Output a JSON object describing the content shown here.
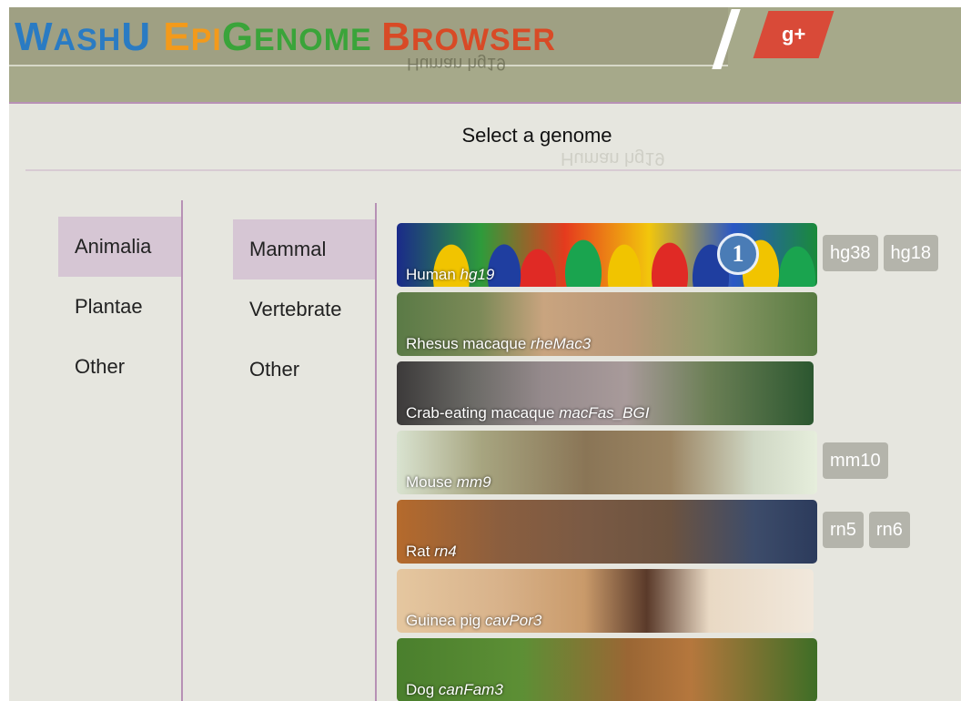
{
  "header": {
    "logo": {
      "parts": [
        {
          "text": "W",
          "class": "c-blue"
        },
        {
          "text": "ASH",
          "class": "c-blue small"
        },
        {
          "text": "U ",
          "class": "c-blue"
        },
        {
          "text": "E",
          "class": "c-orange"
        },
        {
          "text": "PI",
          "class": "c-orange small"
        },
        {
          "text": "G",
          "class": "c-green"
        },
        {
          "text": "ENOME ",
          "class": "c-green small"
        },
        {
          "text": "B",
          "class": "c-red"
        },
        {
          "text": "ROWSER",
          "class": "c-red small"
        }
      ]
    },
    "gplus_label": "g+",
    "mirror_text": "Human hg19"
  },
  "title": "Select a genome",
  "title_ghost": "Human hg19",
  "kingdoms": [
    "Animalia",
    "Plantae",
    "Other"
  ],
  "kingdom_selected": "Animalia",
  "groups": [
    "Mammal",
    "Vertebrate",
    "Other"
  ],
  "group_selected": "Mammal",
  "genomes": [
    {
      "name": "Human",
      "build": "hg19",
      "image": "colorful-figures",
      "alt_builds": [
        "hg38",
        "hg18"
      ]
    },
    {
      "name": "Rhesus macaque",
      "build": "rheMac3",
      "image": "rhesus-macaque-photo",
      "alt_builds": []
    },
    {
      "name": "Crab-eating macaque",
      "build": "macFas_BGI",
      "image": "crab-eating-macaque-photo",
      "alt_builds": []
    },
    {
      "name": "Mouse",
      "build": "mm9",
      "image": "mouse-photo",
      "alt_builds": [
        "mm10"
      ]
    },
    {
      "name": "Rat",
      "build": "rn4",
      "image": "rat-photo",
      "alt_builds": [
        "rn5",
        "rn6"
      ]
    },
    {
      "name": "Guinea pig",
      "build": "cavPor3",
      "image": "guinea-pig-photo",
      "alt_builds": []
    },
    {
      "name": "Dog",
      "build": "canFam3",
      "image": "dog-photo",
      "alt_builds": []
    }
  ],
  "badge": "1",
  "colors": {
    "header": "#a6a98a",
    "accent_lines": "#b791b5",
    "selected_bg": "#d6c6d4",
    "build_button": "#b4b4ab",
    "gplus": "#d94a38",
    "badge": "#4a7cb6"
  }
}
